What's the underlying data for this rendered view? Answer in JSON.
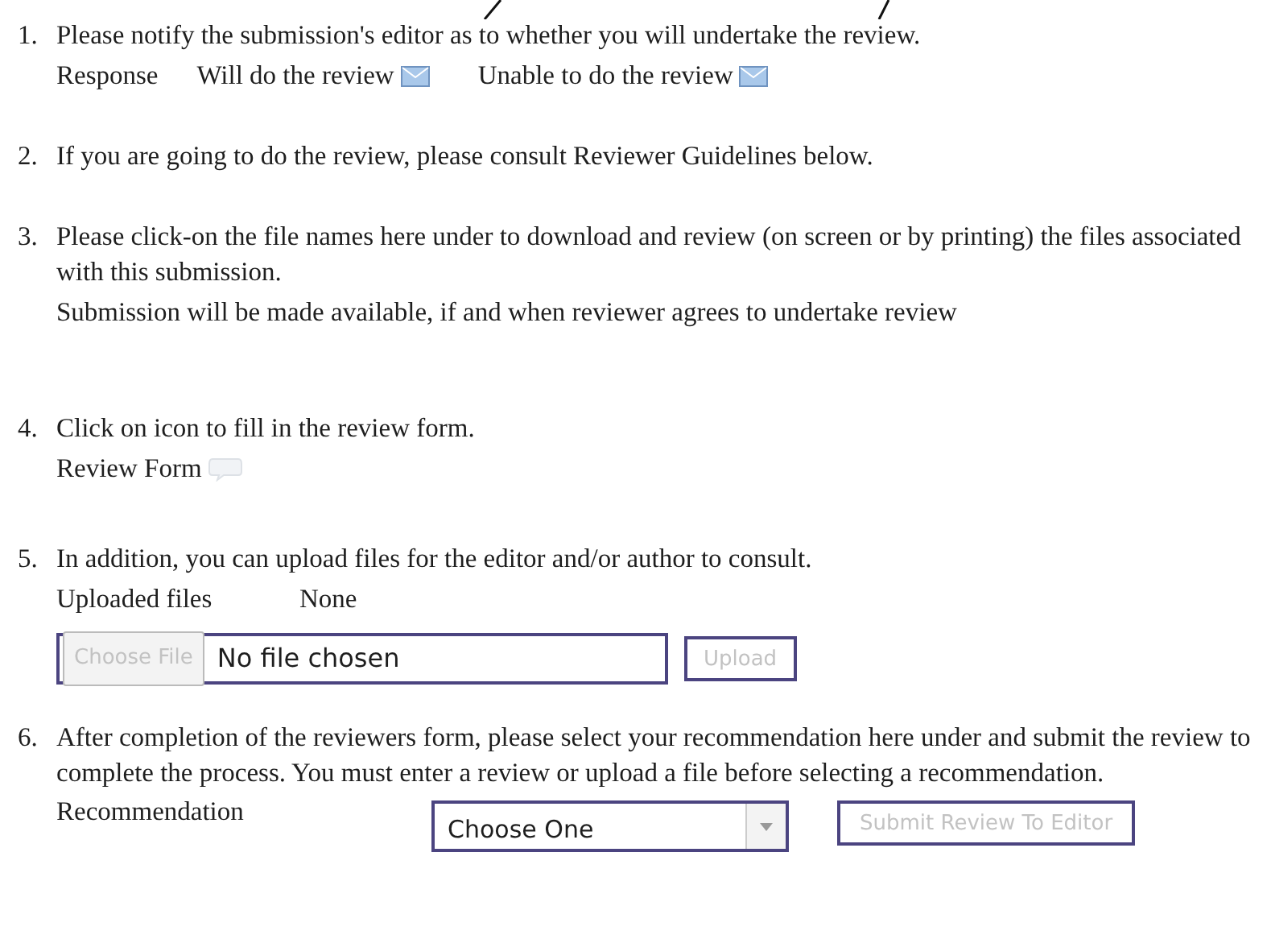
{
  "steps": [
    {
      "number": "1.",
      "text": "Please notify the submission's editor as to whether you will undertake the review.",
      "kind": "response",
      "response_label": "Response",
      "actions": [
        {
          "label": "Will do the review"
        },
        {
          "label": "Unable to do the review"
        }
      ]
    },
    {
      "number": "2.",
      "text": "If you are going to do the review, please consult Reviewer Guidelines below.",
      "kind": "plain"
    },
    {
      "number": "3.",
      "text": "Please click-on the file names here under to download and review (on screen or by printing) the files associated with this submission.",
      "kind": "note",
      "note": "Submission will be made available, if and when reviewer agrees to undertake review"
    },
    {
      "number": "4.",
      "text": "Click on icon to fill in the review form.",
      "kind": "form",
      "form_label": "Review Form"
    },
    {
      "number": "5.",
      "text": "In addition, you can upload files for the editor and/or author to consult.",
      "kind": "upload",
      "files_label": "Uploaded files",
      "files_value": "None",
      "choose_button": "Choose File",
      "file_status": "No file chosen",
      "upload_button": "Upload"
    },
    {
      "number": "6.",
      "text": "After completion of the reviewers form, please select your recommendation here under and submit the review to complete the process. You must enter a review or upload a file before selecting a recommendation.",
      "kind": "recommend",
      "rec_label": "Recommendation",
      "select_value": "Choose One",
      "submit_button": "Submit Review To Editor"
    }
  ]
}
